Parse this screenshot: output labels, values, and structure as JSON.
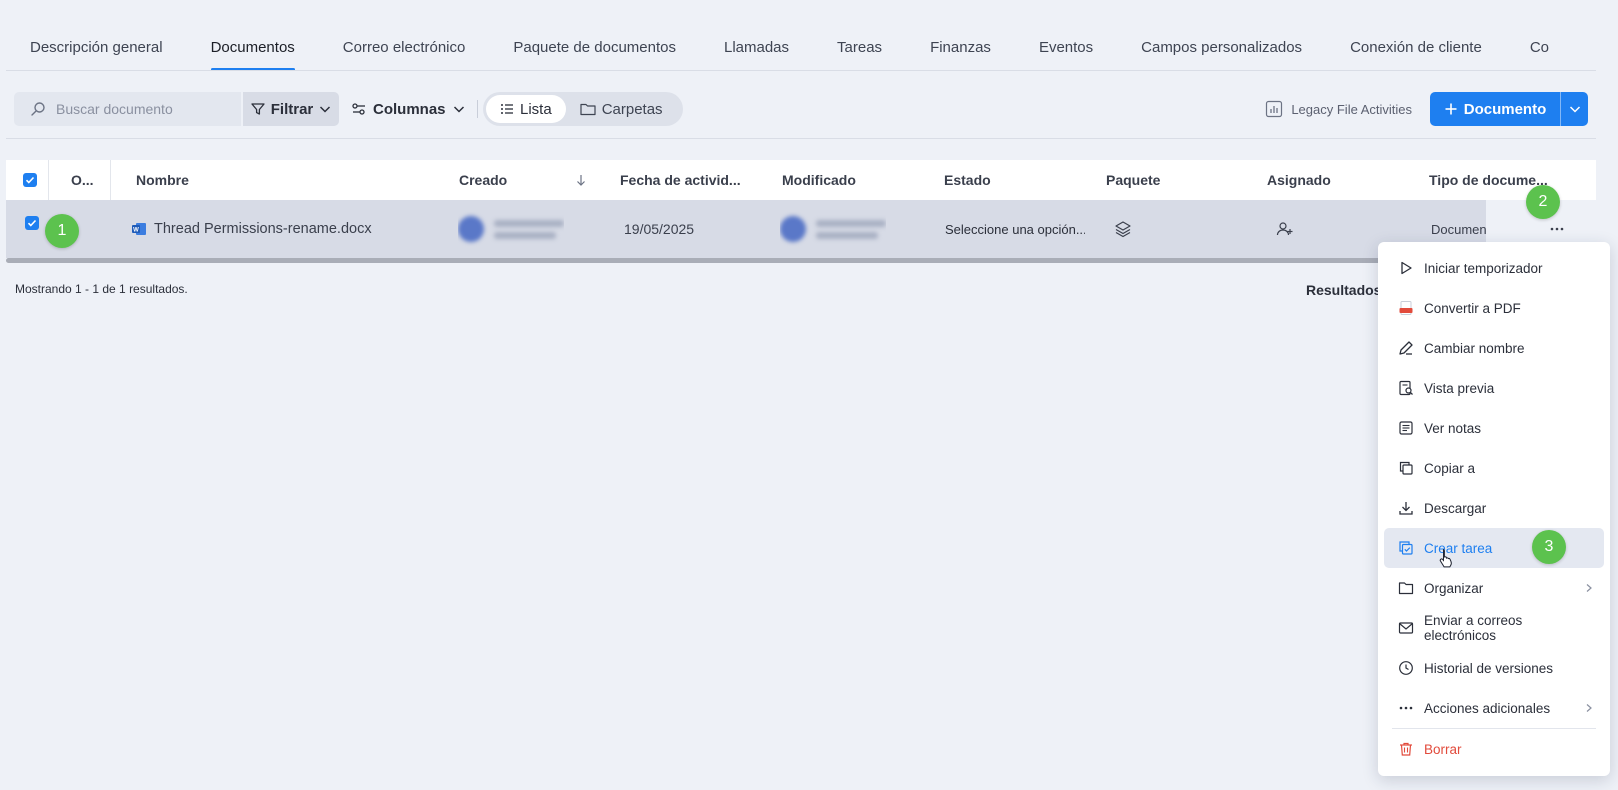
{
  "tabs": [
    {
      "label": "Descripción general",
      "active": false
    },
    {
      "label": "Documentos",
      "active": true
    },
    {
      "label": "Correo electrónico",
      "active": false
    },
    {
      "label": "Paquete de documentos",
      "active": false
    },
    {
      "label": "Llamadas",
      "active": false
    },
    {
      "label": "Tareas",
      "active": false
    },
    {
      "label": "Finanzas",
      "active": false
    },
    {
      "label": "Eventos",
      "active": false
    },
    {
      "label": "Campos personalizados",
      "active": false
    },
    {
      "label": "Conexión de cliente",
      "active": false
    },
    {
      "label": "Co",
      "active": false
    }
  ],
  "toolbar": {
    "search_placeholder": "Buscar documento",
    "filter_label": "Filtrar",
    "columns_label": "Columnas",
    "view_list_label": "Lista",
    "view_folders_label": "Carpetas",
    "legacy_label": "Legacy File Activities",
    "new_document_label": "Documento"
  },
  "table": {
    "headers": {
      "order": "O...",
      "name": "Nombre",
      "created": "Creado",
      "activity_date": "Fecha de activid...",
      "modified": "Modificado",
      "status": "Estado",
      "package": "Paquete",
      "assigned": "Asignado",
      "doc_type": "Tipo de docume..."
    },
    "row": {
      "name": "Thread Permissions-rename.docx",
      "activity_date": "19/05/2025",
      "status": "Seleccione una opción...",
      "doc_type": "Documen"
    }
  },
  "footer": {
    "showing": "Mostrando 1 - 1 de 1 resultados.",
    "results_label": "Resultados"
  },
  "markers": [
    "1",
    "2",
    "3"
  ],
  "menu": {
    "items": [
      {
        "label": "Iniciar temporizador",
        "icon": "play-icon"
      },
      {
        "label": "Convertir a PDF",
        "icon": "pdf-icon"
      },
      {
        "label": "Cambiar nombre",
        "icon": "pencil-icon"
      },
      {
        "label": "Vista previa",
        "icon": "preview-icon"
      },
      {
        "label": "Ver notas",
        "icon": "notes-icon"
      },
      {
        "label": "Copiar a",
        "icon": "copy-icon"
      },
      {
        "label": "Descargar",
        "icon": "download-icon"
      },
      {
        "label": "Crear tarea",
        "icon": "task-icon"
      },
      {
        "label": "Organizar",
        "icon": "folder-icon"
      },
      {
        "label": "Enviar a correos electrónicos",
        "icon": "mail-icon"
      },
      {
        "label": "Historial de versiones",
        "icon": "clock-icon"
      },
      {
        "label": "Acciones adicionales",
        "icon": "more-icon"
      },
      {
        "label": "Borrar",
        "icon": "trash-icon"
      }
    ]
  },
  "colors": {
    "accent": "#1e7ff0",
    "marker": "#5cc24e",
    "danger": "#e24b3c"
  }
}
